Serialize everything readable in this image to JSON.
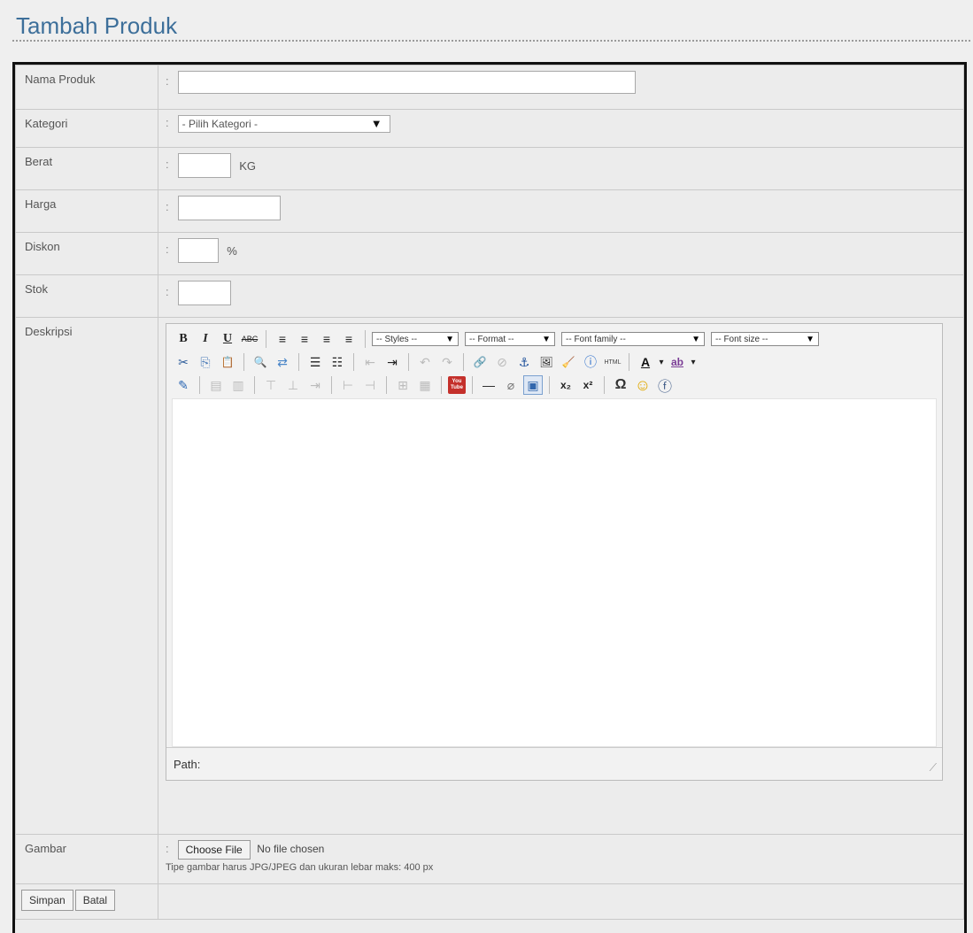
{
  "page": {
    "title": "Tambah Produk"
  },
  "form": {
    "nama": {
      "label": "Nama Produk",
      "value": ""
    },
    "kategori": {
      "label": "Kategori",
      "selected": "- Pilih Kategori -"
    },
    "berat": {
      "label": "Berat",
      "value": "",
      "unit": "KG"
    },
    "harga": {
      "label": "Harga",
      "value": ""
    },
    "diskon": {
      "label": "Diskon",
      "value": "",
      "unit": "%"
    },
    "stok": {
      "label": "Stok",
      "value": ""
    },
    "deskripsi": {
      "label": "Deskripsi"
    },
    "gambar": {
      "label": "Gambar",
      "choose_label": "Choose File",
      "no_file": "No file chosen",
      "hint": "Tipe gambar harus JPG/JPEG dan ukuran lebar maks: 400 px"
    },
    "colon": ":"
  },
  "editor": {
    "styles": "-- Styles --",
    "format": "-- Format --",
    "font_family": "-- Font family --",
    "font_size": "-- Font size --",
    "path_label": "Path:",
    "icons": {
      "bold": "B",
      "italic": "I",
      "underline": "U",
      "strike": "ABC",
      "cut": "✂",
      "copy": "⎘",
      "paste": "📋",
      "find": "🔍",
      "replace": "⇄",
      "bullets": "☰",
      "numbers": "☷",
      "outdent": "⇤",
      "indent": "⇥",
      "undo": "↶",
      "redo": "↷",
      "link": "🔗",
      "unlink": "⊘",
      "anchor": "⚓",
      "image": "🖼",
      "cleanup": "🧹",
      "help": "ⓘ",
      "html": "HTML",
      "forecolor": "A",
      "backcolor": "ab",
      "visualaid": "⊞",
      "table": "▦",
      "youtube": "You Tube",
      "hr": "—",
      "remove": "⌀",
      "fullscreen": "▣",
      "sub": "x₂",
      "sup": "x²",
      "omega": "Ω",
      "emotion": "☺",
      "flash": "ⓕ"
    }
  },
  "actions": {
    "save": "Simpan",
    "cancel": "Batal"
  }
}
